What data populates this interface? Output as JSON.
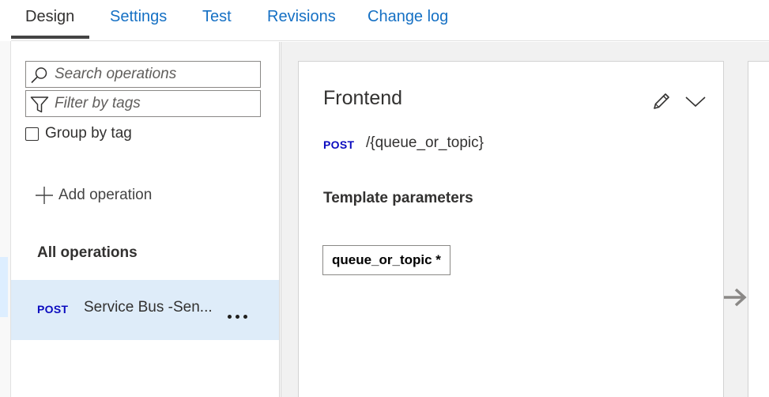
{
  "tabs": [
    {
      "label": "Design",
      "active": true
    },
    {
      "label": "Settings"
    },
    {
      "label": "Test"
    },
    {
      "label": "Revisions"
    },
    {
      "label": "Change log"
    }
  ],
  "ops_panel": {
    "search_placeholder": "Search operations",
    "filter_placeholder": "Filter by tags",
    "group_by_tag_label": "Group by tag",
    "group_by_tag_checked": false,
    "add_operation_label": "Add operation",
    "all_operations_label": "All operations",
    "operations": [
      {
        "method": "POST",
        "name": "Service Bus -Sen...",
        "selected": true
      }
    ]
  },
  "frontend": {
    "title": "Frontend",
    "method": "POST",
    "path": "/{queue_or_topic}",
    "template_parameters_label": "Template parameters",
    "parameters": [
      "queue_or_topic *"
    ]
  },
  "icons": {
    "search": "search-icon",
    "filter": "filter-icon",
    "add": "plus-icon",
    "more": "more-icon",
    "edit": "pencil-icon",
    "collapse": "chevron-down-icon",
    "next": "arrow-right-icon"
  },
  "colors": {
    "link_blue": "#1570c4",
    "method_blue": "#0b0bbf",
    "selected_row": "#deecf9",
    "main_bg": "#f1f1f1"
  }
}
